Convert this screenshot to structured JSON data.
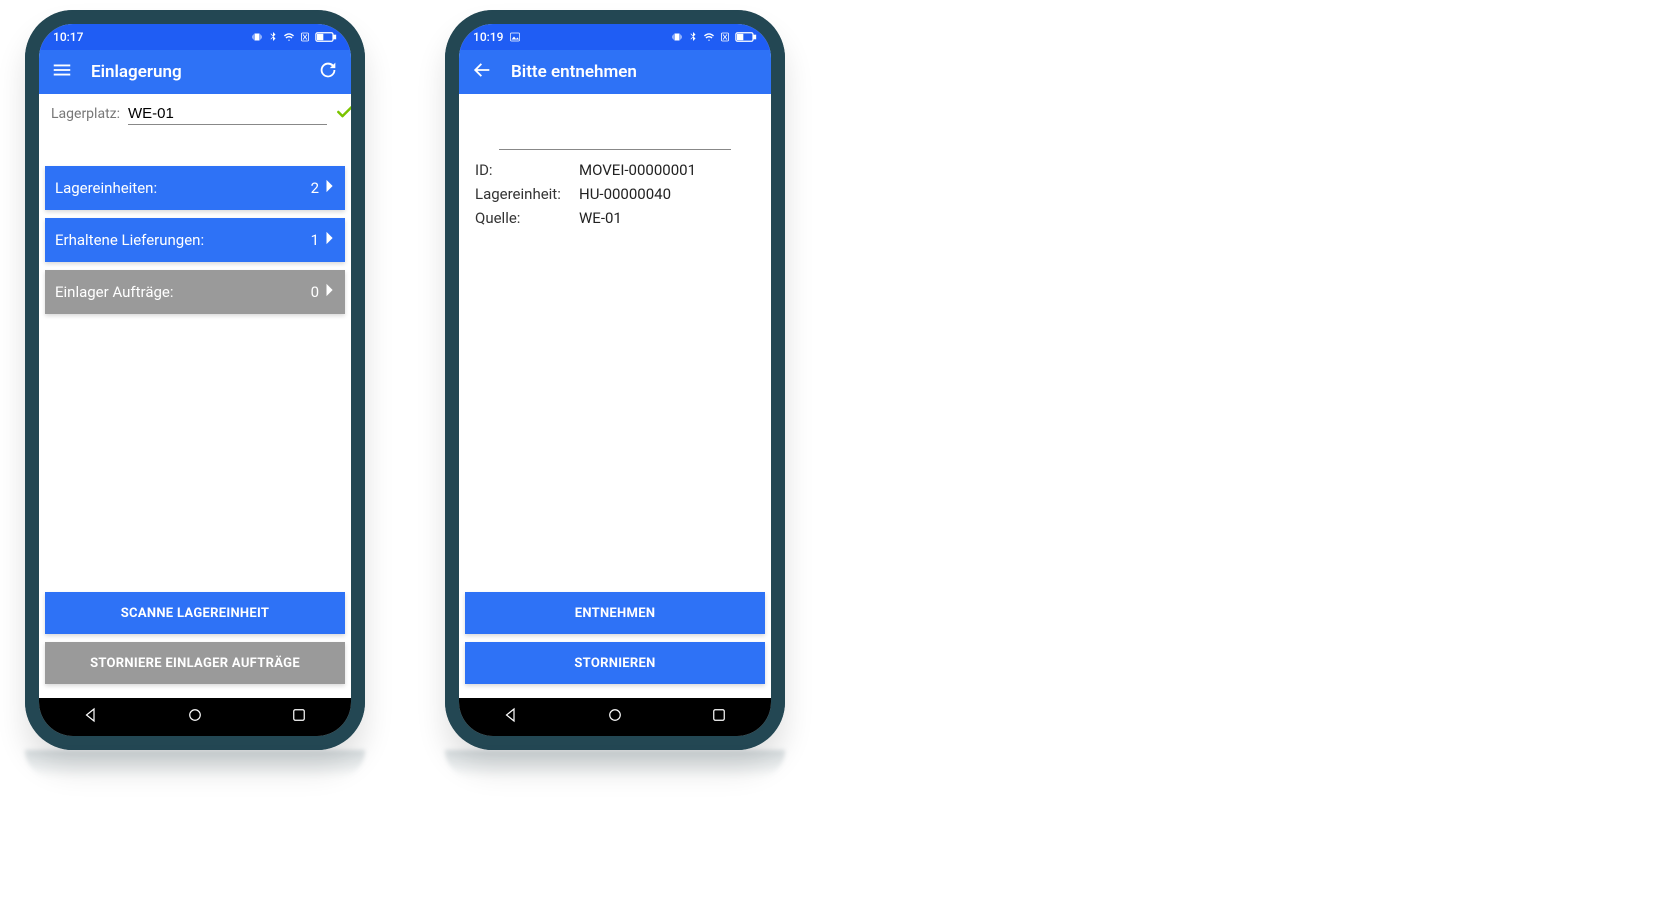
{
  "phones": {
    "left": {
      "status_time": "10:17",
      "app_bar": {
        "title": "Einlagerung"
      },
      "field": {
        "label": "Lagerplatz:",
        "value": "WE-01"
      },
      "items": [
        {
          "label": "Lagereinheiten:",
          "count": "2",
          "active": true
        },
        {
          "label": "Erhaltene Lieferungen:",
          "count": "1",
          "active": true
        },
        {
          "label": "Einlager Aufträge:",
          "count": "0",
          "active": false
        }
      ],
      "buttons": {
        "primary": "SCANNE LAGEREINHEIT",
        "secondary": "STORNIERE EINLAGER AUFTRÄGE"
      }
    },
    "right": {
      "status_time": "10:19",
      "app_bar": {
        "title": "Bitte entnehmen"
      },
      "details": [
        {
          "label": "ID:",
          "value": "MOVEI-00000001"
        },
        {
          "label": "Lagereinheit:",
          "value": "HU-00000040"
        },
        {
          "label": "Quelle:",
          "value": "WE-01"
        }
      ],
      "buttons": {
        "primary": "ENTNEHMEN",
        "secondary": "STORNIEREN"
      }
    }
  }
}
